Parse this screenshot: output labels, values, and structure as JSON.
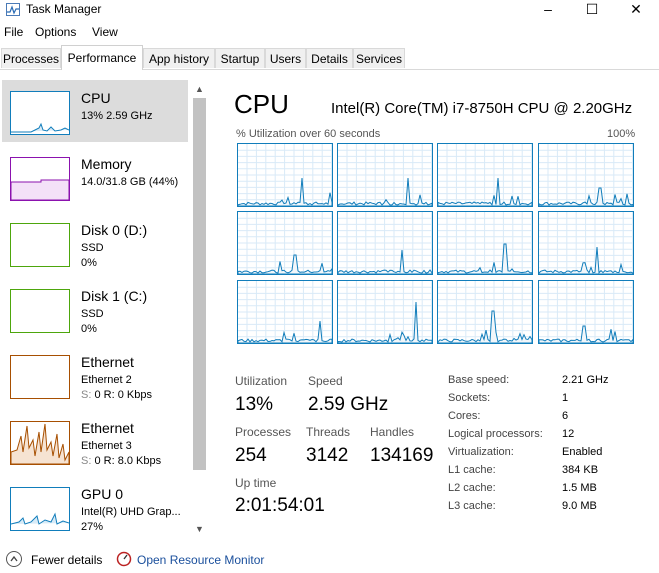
{
  "window": {
    "title": "Task Manager",
    "minimize": "–",
    "maximize": "☐",
    "close": "✕"
  },
  "menu": [
    "File",
    "Options",
    "View"
  ],
  "tabs": [
    "Processes",
    "Performance",
    "App history",
    "Startup",
    "Users",
    "Details",
    "Services"
  ],
  "active_tab": "Performance",
  "sidebar": {
    "items": [
      {
        "name": "CPU",
        "line1": "13%  2.59 GHz",
        "line2": "",
        "color": "#117dbb",
        "icon": "cpu-graph"
      },
      {
        "name": "Memory",
        "line1": "14.0/31.8 GB (44%)",
        "line2": "",
        "color": "#8b12ae",
        "icon": "memory-graph"
      },
      {
        "name": "Disk 0 (D:)",
        "line1": "SSD",
        "line2": "0%",
        "color": "#4da60c",
        "icon": "disk-graph"
      },
      {
        "name": "Disk 1 (C:)",
        "line1": "SSD",
        "line2": "0%",
        "color": "#4da60c",
        "icon": "disk-graph"
      },
      {
        "name": "Ethernet",
        "line1": "Ethernet 2",
        "line2_s": "S:",
        "line2_rest": " 0  R: 0 Kbps",
        "color": "#a74f01",
        "icon": "ethernet-graph"
      },
      {
        "name": "Ethernet",
        "line1": "Ethernet 3",
        "line2_s": "S:",
        "line2_rest": " 0  R: 8.0 Kbps",
        "color": "#a74f01",
        "icon": "ethernet-graph"
      },
      {
        "name": "GPU 0",
        "line1": "Intel(R) UHD Grap...",
        "line2": "27%",
        "color": "#117dbb",
        "icon": "gpu-graph"
      }
    ]
  },
  "main": {
    "title": "CPU",
    "model": "Intel(R) Core(TM) i7-8750H CPU @ 2.20GHz",
    "util_label": "% Utilization over 60 seconds",
    "util_max": "100%",
    "stats": {
      "utilization_label": "Utilization",
      "utilization": "13%",
      "speed_label": "Speed",
      "speed": "2.59 GHz",
      "processes_label": "Processes",
      "processes": "254",
      "threads_label": "Threads",
      "threads": "3142",
      "handles_label": "Handles",
      "handles": "134169",
      "uptime_label": "Up time",
      "uptime": "2:01:54:01"
    },
    "details": [
      {
        "key": "Base speed:",
        "value": "2.21 GHz"
      },
      {
        "key": "Sockets:",
        "value": "1"
      },
      {
        "key": "Cores:",
        "value": "6"
      },
      {
        "key": "Logical processors:",
        "value": "12"
      },
      {
        "key": "Virtualization:",
        "value": "Enabled"
      },
      {
        "key": "L1 cache:",
        "value": "384 KB"
      },
      {
        "key": "L2 cache:",
        "value": "1.5 MB"
      },
      {
        "key": "L3 cache:",
        "value": "9.0 MB"
      }
    ]
  },
  "footer": {
    "fewer_details": "Fewer details",
    "open_resource_monitor": "Open Resource Monitor"
  },
  "colors": {
    "cpu": "#117dbb",
    "memory": "#8b12ae",
    "disk": "#4da60c",
    "ethernet": "#a74f01"
  }
}
